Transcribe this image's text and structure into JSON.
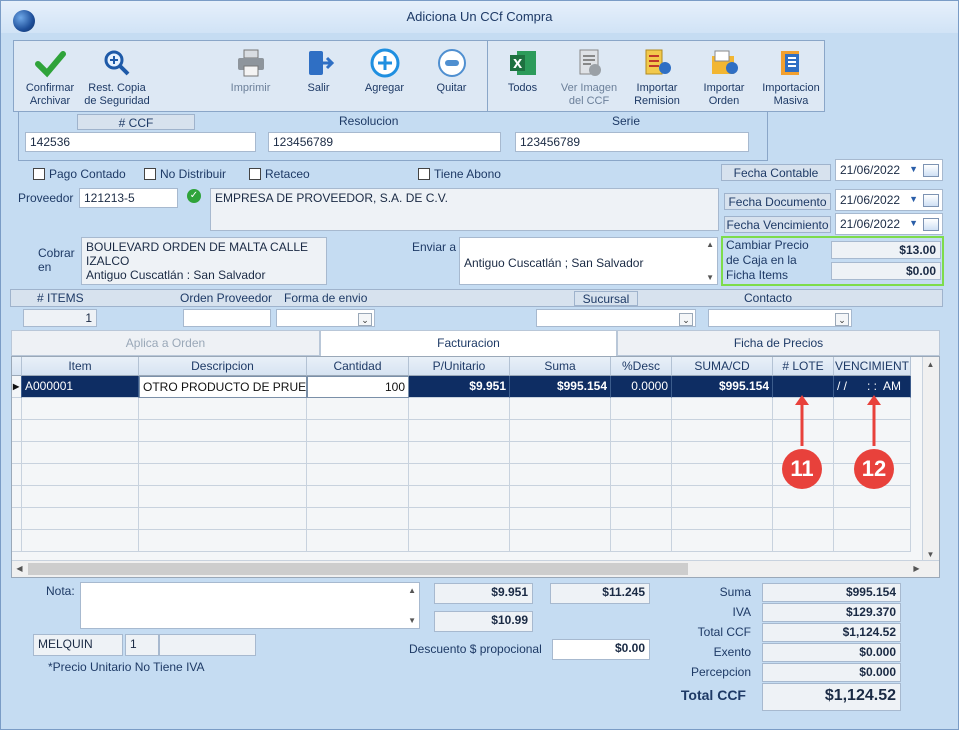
{
  "window": {
    "title": "Adiciona Un CCf Compra"
  },
  "toolbar": {
    "confirm": "Confirmar\nArchivar",
    "restore": "Rest. Copia\nde Seguridad",
    "print": "Imprimir",
    "exit": "Salir",
    "add": "Agregar",
    "remove": "Quitar",
    "all": "Todos",
    "view_image": "Ver Imagen\ndel CCF",
    "import_remision": "Importar\nRemision",
    "import_order": "Importar\nOrden",
    "mass_import": "Importacion\nMasiva"
  },
  "doc": {
    "ccf_label": "# CCF",
    "ccf_value": "142536",
    "resolucion_label": "Resolucion",
    "resolucion_value": "123456789",
    "serie_label": "Serie",
    "serie_value": "123456789"
  },
  "checks": {
    "pago_contado": "Pago Contado",
    "no_distribuir": "No Distribuir",
    "retaceo": "Retaceo",
    "tiene_abono": "Tiene Abono"
  },
  "dates": {
    "fecha_contable_label": "Fecha Contable",
    "fecha_contable": "21/06/2022",
    "fecha_documento_label": "Fecha Documento",
    "fecha_documento": "21/06/2022",
    "fecha_vencimiento_label": "Fecha Vencimiento",
    "fecha_vencimiento": "21/06/2022"
  },
  "proveedor": {
    "label": "Proveedor",
    "code": "121213-5",
    "name": "EMPRESA DE PROVEEDOR, S.A. DE C.V."
  },
  "cobrar": {
    "label": "Cobrar\nen",
    "value": "BOULEVARD ORDEN DE MALTA CALLE\nIZALCO\nAntiguo Cuscatlán : San Salvador"
  },
  "enviar": {
    "label": "Enviar a",
    "value": "Antiguo Cuscatlán ; San Salvador"
  },
  "precio_caja": {
    "label": "Cambiar Precio\nde Caja en la\nFicha Items",
    "price1": "$13.00",
    "price2": "$0.00"
  },
  "info_bar": {
    "items_label": "# ITEMS",
    "items_value": "1",
    "orden_label": "Orden Proveedor",
    "envio_label": "Forma de envio",
    "sucursal_label": "Sucursal",
    "contacto_label": "Contacto"
  },
  "tabs": [
    {
      "label": "Aplica a Orden"
    },
    {
      "label": "Facturacion"
    },
    {
      "label": "Ficha de Precios"
    }
  ],
  "grid": {
    "columns": [
      "Item",
      "Descripcion",
      "Cantidad",
      "P/Unitario",
      "Suma",
      "%Desc",
      "SUMA/CD",
      "# LOTE",
      "VENCIMIENT"
    ],
    "row": {
      "item": "A000001",
      "descripcion": "OTRO PRODUCTO DE PRUE",
      "cantidad": "100",
      "p_unitario": "$9.951",
      "suma": "$995.154",
      "desc": "0.0000",
      "suma_cd": "$995.154",
      "lote": "",
      "vencimiento": "/ /      : :  AM"
    }
  },
  "callouts": {
    "a": "11",
    "b": "12"
  },
  "footer": {
    "nota_label": "Nota:",
    "user": "MELQUIN",
    "user_num": "1",
    "note_iva": "*Precio Unitario No Tiene IVA",
    "price_a": "$9.951",
    "price_b": "$11.245",
    "price_c": "$10.99",
    "descuento_label": "Descuento $ propocional",
    "descuento_value": "$0.00"
  },
  "totals": {
    "suma_label": "Suma",
    "suma": "$995.154",
    "iva_label": "IVA",
    "iva": "$129.370",
    "total_label": "Total CCF",
    "total": "$1,124.52",
    "exento_label": "Exento",
    "exento": "$0.000",
    "percepcion_label": "Percepcion",
    "percepcion": "$0.000",
    "grand_label": "Total CCF",
    "grand": "$1,124.52"
  }
}
